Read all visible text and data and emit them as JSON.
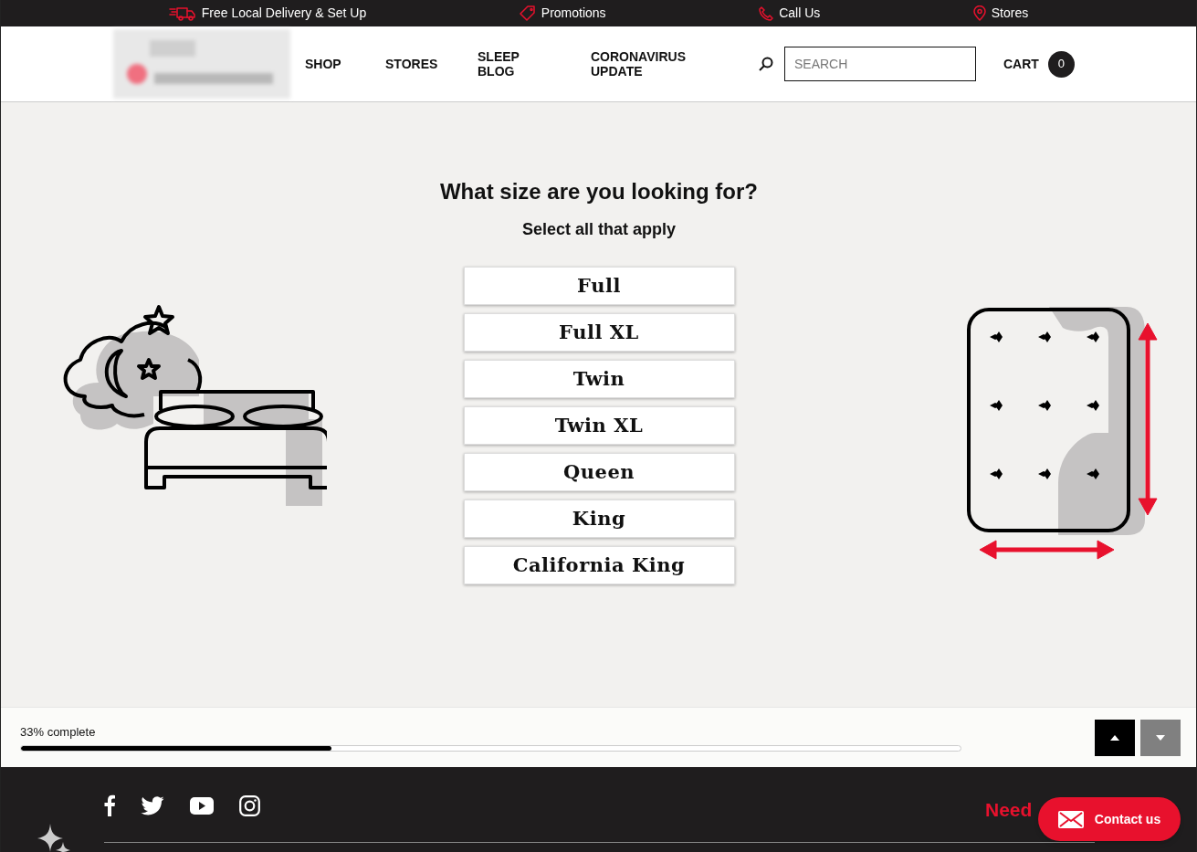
{
  "top_bar": [
    {
      "kind": "truck",
      "label": "Free Local Delivery & Set Up"
    },
    {
      "kind": "tag",
      "label": "Promotions"
    },
    {
      "kind": "phone",
      "label": "Call Us"
    },
    {
      "kind": "pin",
      "label": "Stores"
    }
  ],
  "nav": [
    "SHOP",
    "STORES",
    "SLEEP BLOG",
    "CORONAVIRUS UPDATE"
  ],
  "search": {
    "placeholder": "SEARCH"
  },
  "cart": {
    "label": "CART",
    "count": "0"
  },
  "question": {
    "title": "What size are you looking for?",
    "subtitle": "Select all that apply"
  },
  "options": [
    {
      "label": "Full",
      "selected": false
    },
    {
      "label": "Full XL",
      "selected": false
    },
    {
      "label": "Twin",
      "selected": false
    },
    {
      "label": "Twin XL",
      "selected": false
    },
    {
      "label": "Queen",
      "selected": false
    },
    {
      "label": "King",
      "selected": false
    },
    {
      "label": "California King",
      "selected": false
    }
  ],
  "progress": {
    "label": "33% complete",
    "level": 0.33
  },
  "footer": {
    "heading": "Need",
    "contact_button": "Contact us"
  }
}
